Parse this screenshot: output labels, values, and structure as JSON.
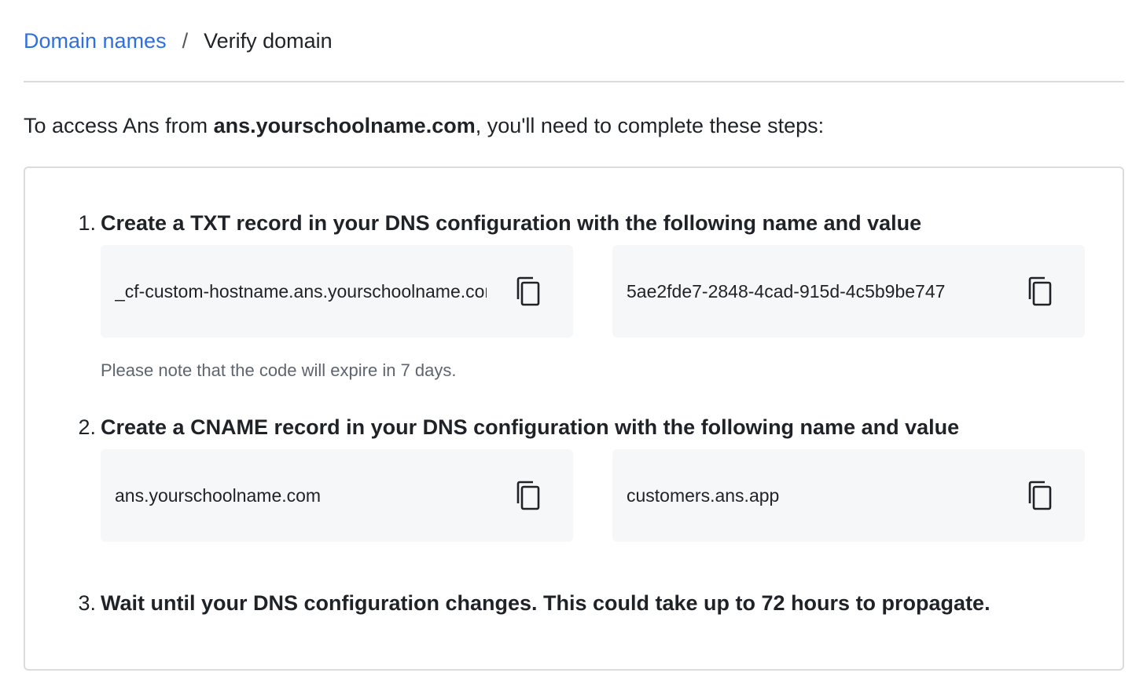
{
  "breadcrumb": {
    "link": "Domain names",
    "separator": "/",
    "current": "Verify domain"
  },
  "intro": {
    "prefix": "To access Ans from ",
    "domain": "ans.yourschoolname.com",
    "suffix": ", you'll need to complete these steps:"
  },
  "steps": [
    {
      "number": "1.",
      "title": "Create a TXT record in your DNS configuration with the following name and value",
      "name_value": "_cf-custom-hostname.ans.yourschoolname.com",
      "value_value": "5ae2fde7-2848-4cad-915d-4c5b9be747",
      "note": "Please note that the code will expire in 7 days."
    },
    {
      "number": "2.",
      "title": "Create a CNAME record in your DNS configuration with the following name and value",
      "name_value": "ans.yourschoolname.com",
      "value_value": "customers.ans.app"
    },
    {
      "number": "3.",
      "title": "Wait until your DNS configuration changes. This could take up to 72 hours to propagate."
    }
  ],
  "icons": {
    "copy": "copy-icon"
  }
}
